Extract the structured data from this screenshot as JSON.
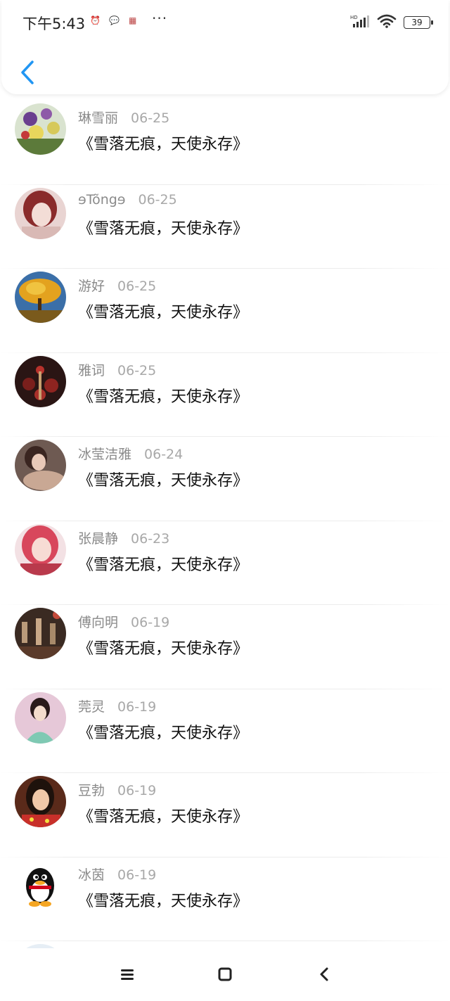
{
  "status_bar": {
    "time": "下午5:43",
    "network": "HD",
    "battery": "39",
    "mini_icons": [
      "alarm-icon",
      "chat-bubble-icon",
      "calendar-icon"
    ]
  },
  "header": {
    "back_icon": "chevron-left-icon",
    "accent_color": "#2196F3"
  },
  "comments": [
    {
      "name": "琳雪丽",
      "date": "06-25",
      "text": "《雪落无痕，天使永存》"
    },
    {
      "name": "ɘTo͂ngɘ",
      "date": "06-25",
      "text": "《雪落无痕，天使永存》"
    },
    {
      "name": "游好",
      "date": "06-25",
      "text": "《雪落无痕，天使永存》"
    },
    {
      "name": "雅词",
      "date": "06-25",
      "text": "《雪落无痕，天使永存》"
    },
    {
      "name": "冰莹洁雅",
      "date": "06-24",
      "text": "《雪落无痕，天使永存》"
    },
    {
      "name": "张晨静",
      "date": "06-23",
      "text": "《雪落无痕，天使永存》"
    },
    {
      "name": "傅向明",
      "date": "06-19",
      "text": "《雪落无痕，天使永存》"
    },
    {
      "name": "莞灵",
      "date": "06-19",
      "text": "《雪落无痕，天使永存》"
    },
    {
      "name": "豆勃",
      "date": "06-19",
      "text": "《雪落无痕，天使永存》"
    },
    {
      "name": "冰茵",
      "date": "06-19",
      "text": "《雪落无痕，天使永存》"
    }
  ],
  "nav_bar": {
    "icons": [
      "menu-icon",
      "home-square-icon",
      "back-arrow-icon"
    ]
  }
}
